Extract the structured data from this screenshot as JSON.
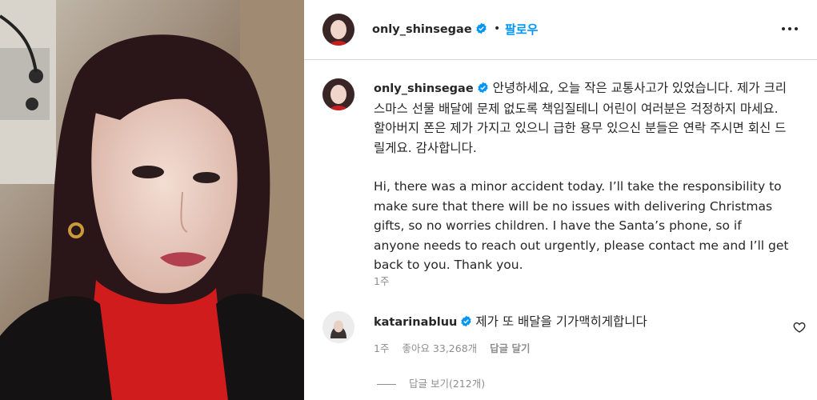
{
  "header": {
    "username": "only_shinsegae",
    "separator": "•",
    "follow_label": "팔로우"
  },
  "caption": {
    "username": "only_shinsegae",
    "text_ko": "안녕하세요, 오늘 작은 교통사고가 있었습니다. 제가 크리스마스 선물 배달에 문제 없도록 책임질테니 어린이 여러분은 걱정하지 마세요. 할아버지 폰은 제가 가지고 있으니 급한 용무 있으신 분들은 연락 주시면 회신 드릴게요. 감사합니다.",
    "text_en": "Hi, there was a minor accident today. I’ll take the responsibility to make sure that there will be no issues with delivering Christmas gifts, so no worries children. I have the Santa’s phone, so if anyone needs to reach out urgently, please contact me and I’ll get back to you. Thank you.",
    "time": "1주"
  },
  "comment": {
    "username": "katarinabluu",
    "text": "제가 또 배달을 기가맥히게합니다",
    "time": "1주",
    "likes": "좋아요 33,268개",
    "reply_label": "답글 달기",
    "view_replies": "답글 보기(212개)"
  },
  "colors": {
    "verified": "#0095f6",
    "follow": "#0095f6",
    "secondary_text": "#8e8e8e",
    "divider": "#dbdbdb"
  },
  "icons": {
    "verified": "verified-badge-icon",
    "more": "more-options-icon",
    "like": "heart-icon"
  }
}
